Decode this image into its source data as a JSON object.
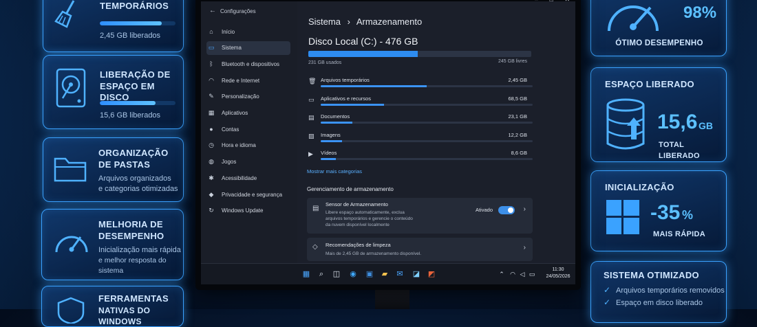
{
  "left_cards": [
    {
      "title": "TEMPORÁRIOS",
      "text": "2,45 GB liberados",
      "progress": 0.82
    },
    {
      "title_lines": [
        "LIBERAÇÃO DE",
        "ESPAÇO EM DISCO"
      ],
      "text": "15,6 GB liberados",
      "progress": 0.74
    },
    {
      "title_lines": [
        "ORGANIZAÇÃO",
        "DE PASTAS"
      ],
      "text_lines": [
        "Arquivos organizados",
        "e categorias otimizadas"
      ]
    },
    {
      "title_lines": [
        "MELHORIA DE",
        "DESEMPENHO"
      ],
      "text_lines": [
        "Inicialização mais rápida",
        "e melhor resposta do sistema"
      ]
    },
    {
      "title_lines": [
        "FERRAMENTAS",
        "NATIVAS DO WINDOWS"
      ]
    }
  ],
  "right_cards": {
    "performance": {
      "value": "98%",
      "label": "ÓTIMO DESEMPENHO"
    },
    "space": {
      "title": "ESPAÇO LIBERADO",
      "value": "15,6",
      "unit": "GB",
      "label": "TOTAL LIBERADO"
    },
    "startup": {
      "title": "INICIALIZAÇÃO",
      "value": "-35",
      "unit": "%",
      "label": "MAIS RÁPIDA"
    },
    "optimized": {
      "title": "SISTEMA OTIMIZADO",
      "items": [
        "Arquivos temporários removidos",
        "Espaço em disco liberado"
      ]
    }
  },
  "settings": {
    "app_title": "Configurações",
    "nav": [
      {
        "icon": "home-icon",
        "glyph": "⌂",
        "label": "Início"
      },
      {
        "icon": "system-icon",
        "glyph": "▭",
        "label": "Sistema",
        "selected": true
      },
      {
        "icon": "bluetooth-icon",
        "glyph": "ᛒ",
        "label": "Bluetooth e dispositivos"
      },
      {
        "icon": "wifi-icon",
        "glyph": "◠",
        "label": "Rede e Internet"
      },
      {
        "icon": "brush-icon",
        "glyph": "✎",
        "label": "Personalização"
      },
      {
        "icon": "apps-icon",
        "glyph": "▦",
        "label": "Aplicativos"
      },
      {
        "icon": "accounts-icon",
        "glyph": "●",
        "label": "Contas"
      },
      {
        "icon": "clock-icon",
        "glyph": "◷",
        "label": "Hora e idioma"
      },
      {
        "icon": "games-icon",
        "glyph": "◍",
        "label": "Jogos"
      },
      {
        "icon": "accessibility-icon",
        "glyph": "✱",
        "label": "Acessibilidade"
      },
      {
        "icon": "shield-icon",
        "glyph": "◆",
        "label": "Privacidade e segurança"
      },
      {
        "icon": "update-icon",
        "glyph": "↻",
        "label": "Windows Update"
      }
    ],
    "breadcrumb_parent": "Sistema",
    "breadcrumb_sep": "›",
    "breadcrumb_current": "Armazenamento",
    "disk_title": "Disco Local (C:) - 476 GB",
    "used": "231 GB usados",
    "free": "245 GB livres",
    "used_fraction": 0.49,
    "categories": [
      {
        "icon": "trash-icon",
        "glyph": "🗑",
        "name": "Arquivos temporários",
        "value": "2,45 GB",
        "fraction": 0.5
      },
      {
        "icon": "apps-icon",
        "glyph": "▭",
        "name": "Aplicativos e recursos",
        "value": "68,5 GB",
        "fraction": 0.3
      },
      {
        "icon": "document-icon",
        "glyph": "▤",
        "name": "Documentos",
        "value": "23,1 GB",
        "fraction": 0.15
      },
      {
        "icon": "image-icon",
        "glyph": "▨",
        "name": "Imagens",
        "value": "12,2 GB",
        "fraction": 0.1
      },
      {
        "icon": "video-icon",
        "glyph": "▶",
        "name": "Vídeos",
        "value": "8,6 GB",
        "fraction": 0.07
      }
    ],
    "more_categories": "Mostrar mais categorias",
    "management_header": "Gerenciamento de armazenamento",
    "sensor": {
      "title": "Sensor de Armazenamento",
      "desc_lines": [
        "Libere espaço automaticamente, exclua",
        "arquivos temporários e gerencie o conteúdo",
        "da nuvem disponível localmente"
      ],
      "state": "Ativado"
    },
    "cleanup": {
      "title": "Recomendações de limpeza",
      "desc": "Mais de 2,45 GB de armazenamento disponível."
    },
    "time": "11:30",
    "date": "24/05/2026"
  }
}
